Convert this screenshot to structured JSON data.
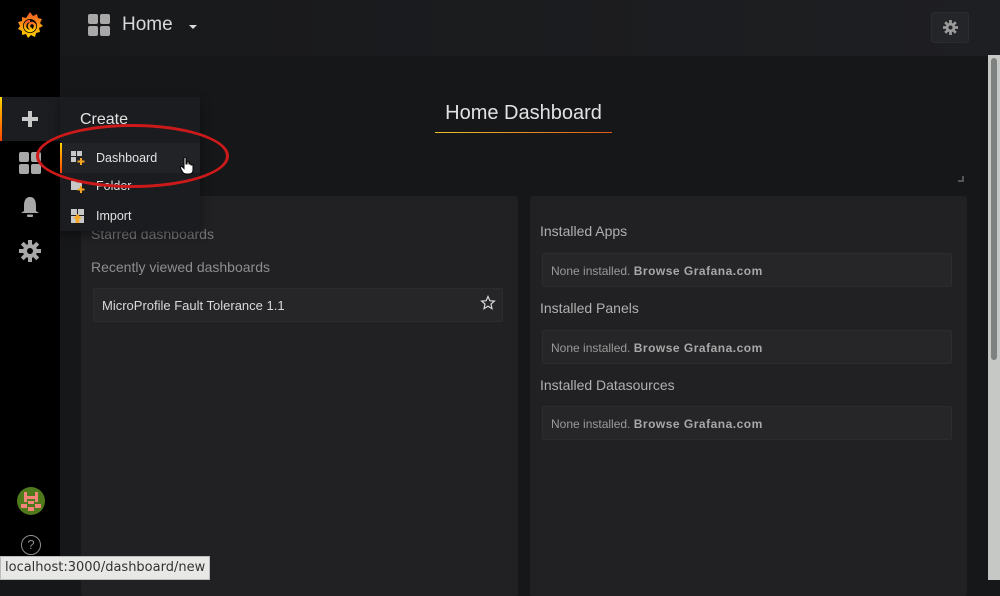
{
  "navbar": {
    "title": "Home",
    "icons": {
      "logo": "grafana-logo",
      "dashboards": "apps-grid-icon",
      "settings": "gear-icon"
    }
  },
  "sidemenu": {
    "items": [
      {
        "name": "create",
        "icon": "plus-icon",
        "active": true
      },
      {
        "name": "dashboards",
        "icon": "apps-grid-icon"
      },
      {
        "name": "alerting",
        "icon": "bell-icon"
      },
      {
        "name": "configuration",
        "icon": "gear-icon"
      }
    ],
    "bottom": [
      {
        "name": "profile",
        "icon": "avatar"
      },
      {
        "name": "help",
        "icon": "question-icon",
        "glyph": "?"
      }
    ]
  },
  "create_menu": {
    "header": "Create",
    "items": [
      {
        "label": "Dashboard",
        "icon": "dashboard-add-icon",
        "active": true
      },
      {
        "label": "Folder",
        "icon": "folder-add-icon"
      },
      {
        "label": "Import",
        "icon": "import-icon"
      }
    ]
  },
  "main": {
    "title": "Home Dashboard",
    "left_panel": {
      "starred_heading": "Starred dashboards",
      "recent_heading": "Recently viewed dashboards",
      "recent": [
        {
          "title": "MicroProfile Fault Tolerance 1.1",
          "starred": false
        }
      ]
    },
    "right_panel": {
      "sections": [
        {
          "heading": "Installed Apps",
          "empty_text": "None installed.",
          "link": "Browse Grafana.com"
        },
        {
          "heading": "Installed Panels",
          "empty_text": "None installed.",
          "link": "Browse Grafana.com"
        },
        {
          "heading": "Installed Datasources",
          "empty_text": "None installed.",
          "link": "Browse Grafana.com"
        }
      ]
    }
  },
  "status_bar": {
    "url": "localhost:3000/dashboard/new"
  },
  "colors": {
    "accent_start": "#ffd500",
    "accent_end": "#ff4400",
    "annotation": "#cc1a1a",
    "background": "#161719",
    "panel": "#212124"
  }
}
